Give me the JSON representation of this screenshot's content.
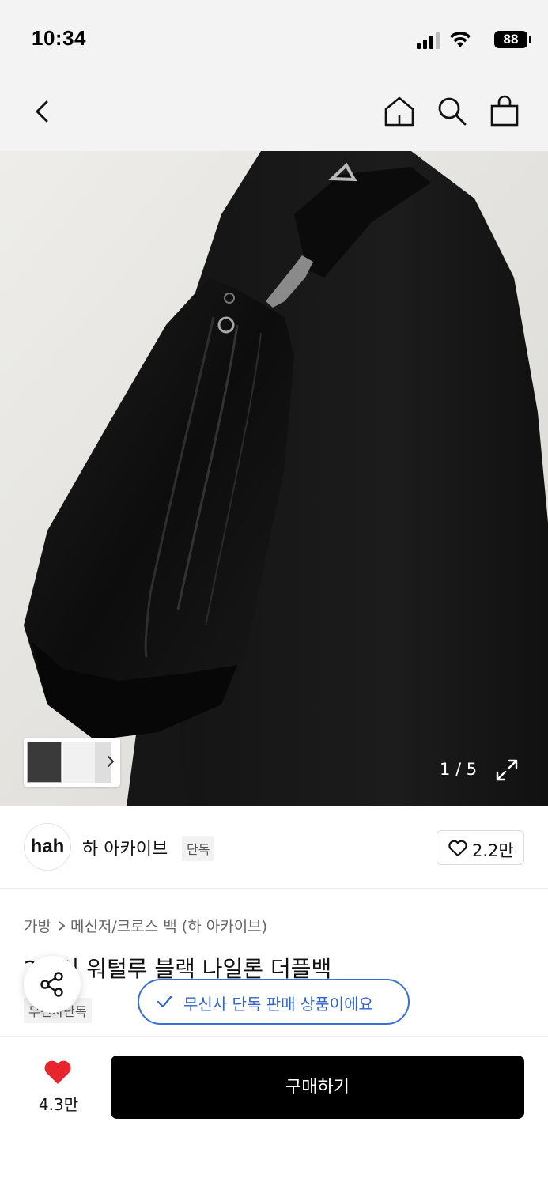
{
  "status_bar": {
    "time": "10:34",
    "battery": "88",
    "icons": [
      "signal-icon",
      "wifi-icon",
      "battery-icon"
    ]
  },
  "nav": {
    "icons": [
      "back-icon",
      "home-icon",
      "search-icon",
      "shopping-bag-icon"
    ]
  },
  "gallery": {
    "page_indicator": "1 / 5",
    "current_page": 1,
    "total_pages": 5,
    "icons": [
      "chevron-right-icon",
      "expand-icon"
    ]
  },
  "brand": {
    "logo_text": "hah",
    "name": "하 아카이브",
    "tag": "단독",
    "like_count": "2.2만"
  },
  "product": {
    "breadcrumb": [
      "가방",
      "메신저/크로스 백 (하 아카이브)"
    ],
    "title": "24 이 워털루 블랙 나일론 더플백",
    "tag": "무신사단독"
  },
  "toast": {
    "text": "무신사 단독 판매 상품이에요"
  },
  "bottom_bar": {
    "wish_count": "4.3만",
    "buy_label": "구매하기"
  },
  "colors": {
    "accent_blue": "#2f63cf",
    "heart_red": "#e8242c",
    "buy_black": "#000000",
    "header_bg": "#f3f3f4"
  }
}
